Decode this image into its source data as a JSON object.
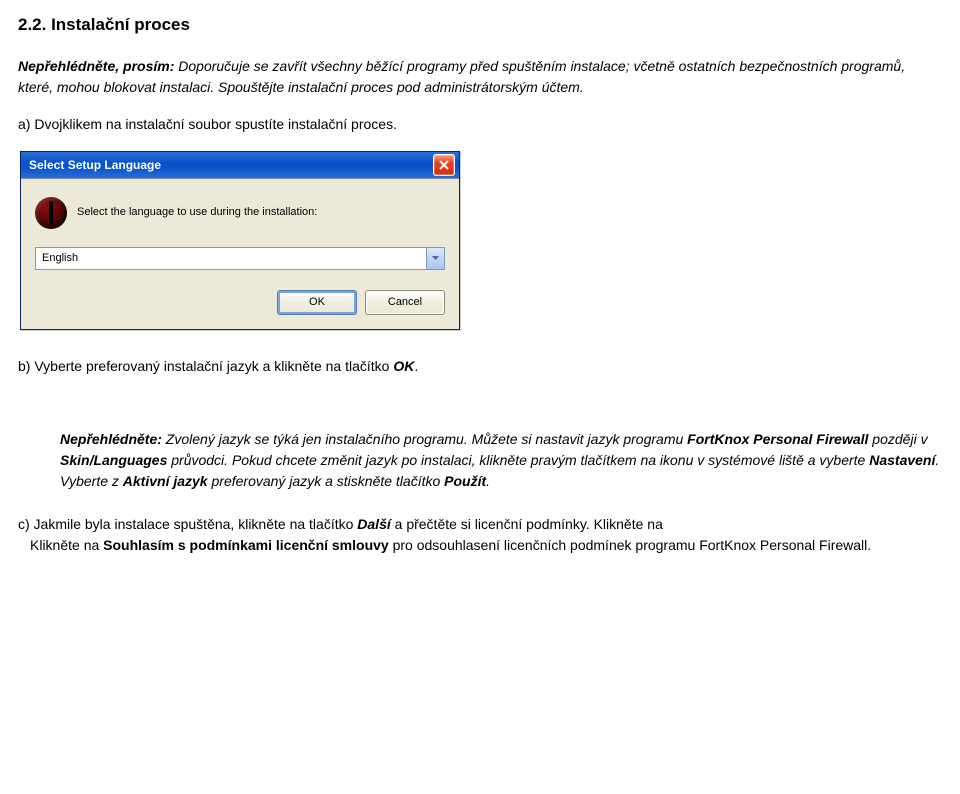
{
  "heading": "2.2. Instalační proces",
  "para1": {
    "lead": "Nepřehlédněte, prosím:",
    "body": " Doporučuje se zavřít všechny běžící programy před spuštěním instalace; včetně ostatních bezpečnostních programů, které, mohou blokovat instalaci. Spouštějte instalační proces pod administrátorským účtem."
  },
  "para_a": "a) Dvojklikem na instalační soubor spustíte instalační proces.",
  "dialog": {
    "title": "Select Setup Language",
    "prompt": "Select the language to use during the installation:",
    "value": "English",
    "ok": "OK",
    "cancel": "Cancel"
  },
  "para_b": {
    "t1": "b) Vyberte preferovaný instalační jazyk a klikněte na tlačítko ",
    "ok": "OK",
    "t2": "."
  },
  "note": {
    "lead": "Nepřehlédněte:",
    "s1": " Zvolený jazyk se týká jen instalačního programu. Můžete si nastavit jazyk programu ",
    "prod": "FortKnox Personal Firewall",
    "s2": " později v ",
    "skin": "Skin/Languages",
    "s3": " průvodci. Pokud chcete změnit jazyk po instalaci, klikněte pravým tlačítkem na ikonu v systémové liště a vyberte ",
    "nast": "Nastavení",
    "s4": ". Vyberte z ",
    "aktivni": "Aktivní jazyk",
    "s5": " preferovaný jazyk a stiskněte tlačítko ",
    "pouzit": "Použít",
    "s6": "."
  },
  "para_c": {
    "t1": "c) Jakmile byla instalace spuštěna, klikněte na tlačítko ",
    "dalsi": "Další",
    "t2": " a přečtěte si licenční podmínky. Klikněte na ",
    "souhl": "Souhlasím s podmínkami licenční smlouvy",
    "t3": " pro odsouhlasení licenčních podmínek programu FortKnox Personal Firewall."
  }
}
